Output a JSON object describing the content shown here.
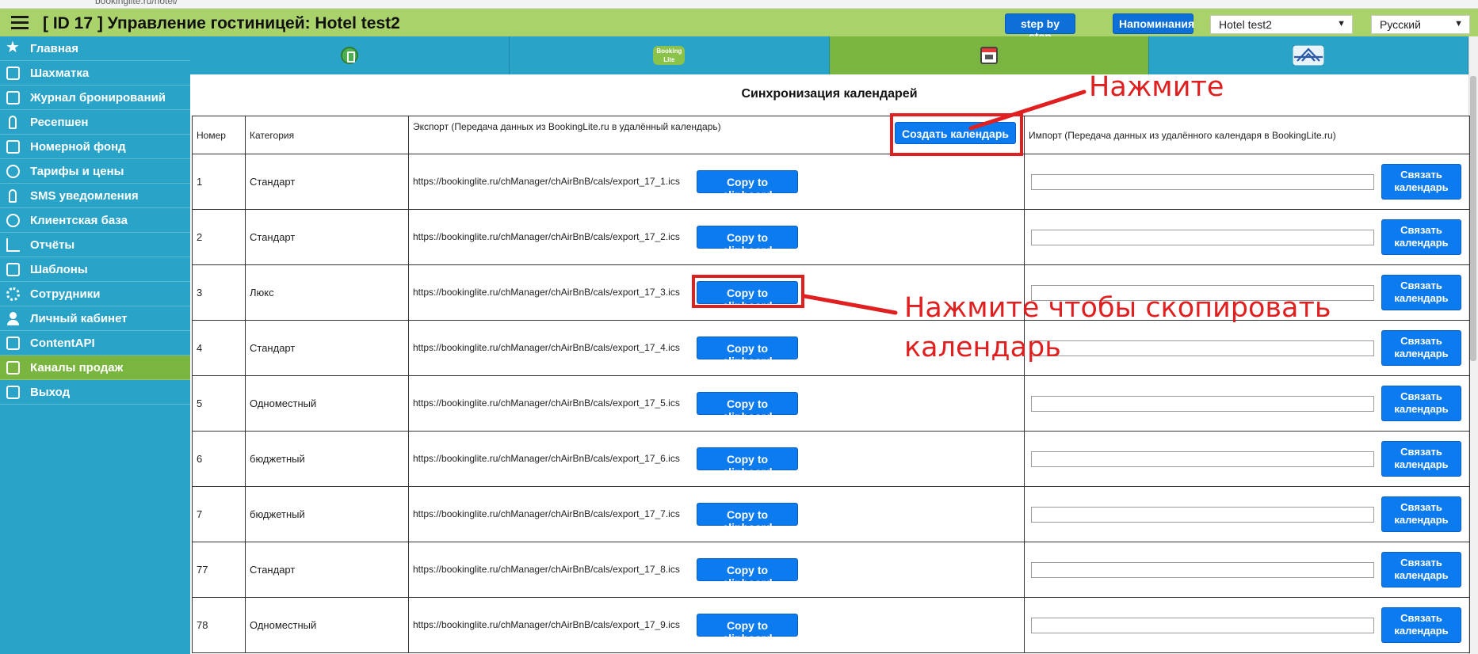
{
  "browser": {
    "url": "bookinglite.ru/hotel/"
  },
  "header": {
    "title": "[ ID 17 ] Управление гостиницей: Hotel test2",
    "step_btn": "step by step",
    "reminders_btn": "Напоминания",
    "hotel_select": "Hotel test2",
    "lang_select": "Русский"
  },
  "sidebar": {
    "items": [
      {
        "label": "Главная",
        "icon": "star-icon"
      },
      {
        "label": "Шахматка",
        "icon": "board-icon"
      },
      {
        "label": "Журнал бронирований",
        "icon": "journal-icon"
      },
      {
        "label": "Ресепшен",
        "icon": "reception-icon"
      },
      {
        "label": "Номерной фонд",
        "icon": "bed-icon"
      },
      {
        "label": "Тарифы и цены",
        "icon": "wallet-icon"
      },
      {
        "label": "SMS уведомления",
        "icon": "phone-icon"
      },
      {
        "label": "Клиентская база",
        "icon": "client-icon"
      },
      {
        "label": "Отчёты",
        "icon": "chart-icon"
      },
      {
        "label": "Шаблоны",
        "icon": "template-icon"
      },
      {
        "label": "Сотрудники",
        "icon": "gear-icon"
      },
      {
        "label": "Личный кабинет",
        "icon": "person-icon"
      },
      {
        "label": "ContentAPI",
        "icon": "api-icon"
      },
      {
        "label": "Каналы продаж",
        "icon": "channels-icon"
      },
      {
        "label": "Выход",
        "icon": "exit-icon"
      }
    ],
    "active_index": 13
  },
  "tabs": [
    {
      "icon": "booking-book-icon"
    },
    {
      "icon": "bookinglite-logo-icon",
      "text": "Booking Lite"
    },
    {
      "icon": "calendar-icon"
    },
    {
      "icon": "airbnb-logo-icon"
    }
  ],
  "main": {
    "title": "Синхронизация календарей",
    "columns": {
      "number": "Номер",
      "category": "Категория",
      "export": "Экспорт (Передача данных из BookingLite.ru в удалённый календарь)",
      "import": "Импорт (Передача данных из удалённого календаря в BookingLite.ru)"
    },
    "create_btn": "Создать календарь",
    "copy_btn": "Copy to clipboard",
    "link_btn": "Связать календарь",
    "rows": [
      {
        "number": "1",
        "category": "Стандарт",
        "url": "https://bookinglite.ru/chManager/chAirBnB/cals/export_17_1.ics"
      },
      {
        "number": "2",
        "category": "Стандарт",
        "url": "https://bookinglite.ru/chManager/chAirBnB/cals/export_17_2.ics"
      },
      {
        "number": "3",
        "category": "Люкс",
        "url": "https://bookinglite.ru/chManager/chAirBnB/cals/export_17_3.ics"
      },
      {
        "number": "4",
        "category": "Стандарт",
        "url": "https://bookinglite.ru/chManager/chAirBnB/cals/export_17_4.ics"
      },
      {
        "number": "5",
        "category": "Одноместный",
        "url": "https://bookinglite.ru/chManager/chAirBnB/cals/export_17_5.ics"
      },
      {
        "number": "6",
        "category": "бюджетный",
        "url": "https://bookinglite.ru/chManager/chAirBnB/cals/export_17_6.ics"
      },
      {
        "number": "7",
        "category": "бюджетный",
        "url": "https://bookinglite.ru/chManager/chAirBnB/cals/export_17_7.ics"
      },
      {
        "number": "77",
        "category": "Стандарт",
        "url": "https://bookinglite.ru/chManager/chAirBnB/cals/export_17_8.ics"
      },
      {
        "number": "78",
        "category": "Одноместный",
        "url": "https://bookinglite.ru/chManager/chAirBnB/cals/export_17_9.ics"
      }
    ]
  },
  "annotations": {
    "press": "Нажмите",
    "press_copy_line1": "Нажмите чтобы скопировать",
    "press_copy_line2": "календарь",
    "color": "#e02020"
  },
  "colors": {
    "topbar": "#a9d26a",
    "sidebar": "#2aa3c9",
    "active": "#7ab63f",
    "button": "#0d7bf0"
  }
}
